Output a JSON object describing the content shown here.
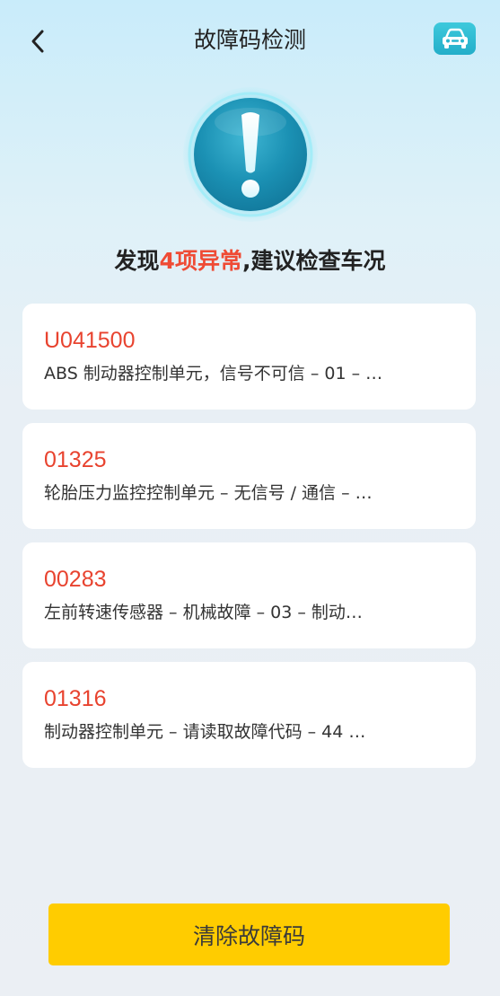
{
  "header": {
    "title": "故障码检测",
    "back_icon": "chevron-left-icon",
    "car_icon": "car-icon"
  },
  "colors": {
    "accent_red": "#e8432f",
    "button_yellow": "#ffcc00",
    "teal": "#23aec9"
  },
  "summary": {
    "prefix": "发现",
    "highlight": "4项异常",
    "suffix": ",建议检查车况",
    "alert_icon": "exclamation-icon"
  },
  "faults": [
    {
      "code": "U041500",
      "desc": "ABS 制动器控制单元，信号不可信 – 01 – …"
    },
    {
      "code": "01325",
      "desc": "轮胎压力监控控制单元 – 无信号 / 通信 – …"
    },
    {
      "code": "00283",
      "desc": "左前转速传感器 – 机械故障 – 03 – 制动…"
    },
    {
      "code": "01316",
      "desc": "制动器控制单元 – 请读取故障代码 – 44 …"
    }
  ],
  "footer": {
    "clear_label": "清除故障码"
  }
}
